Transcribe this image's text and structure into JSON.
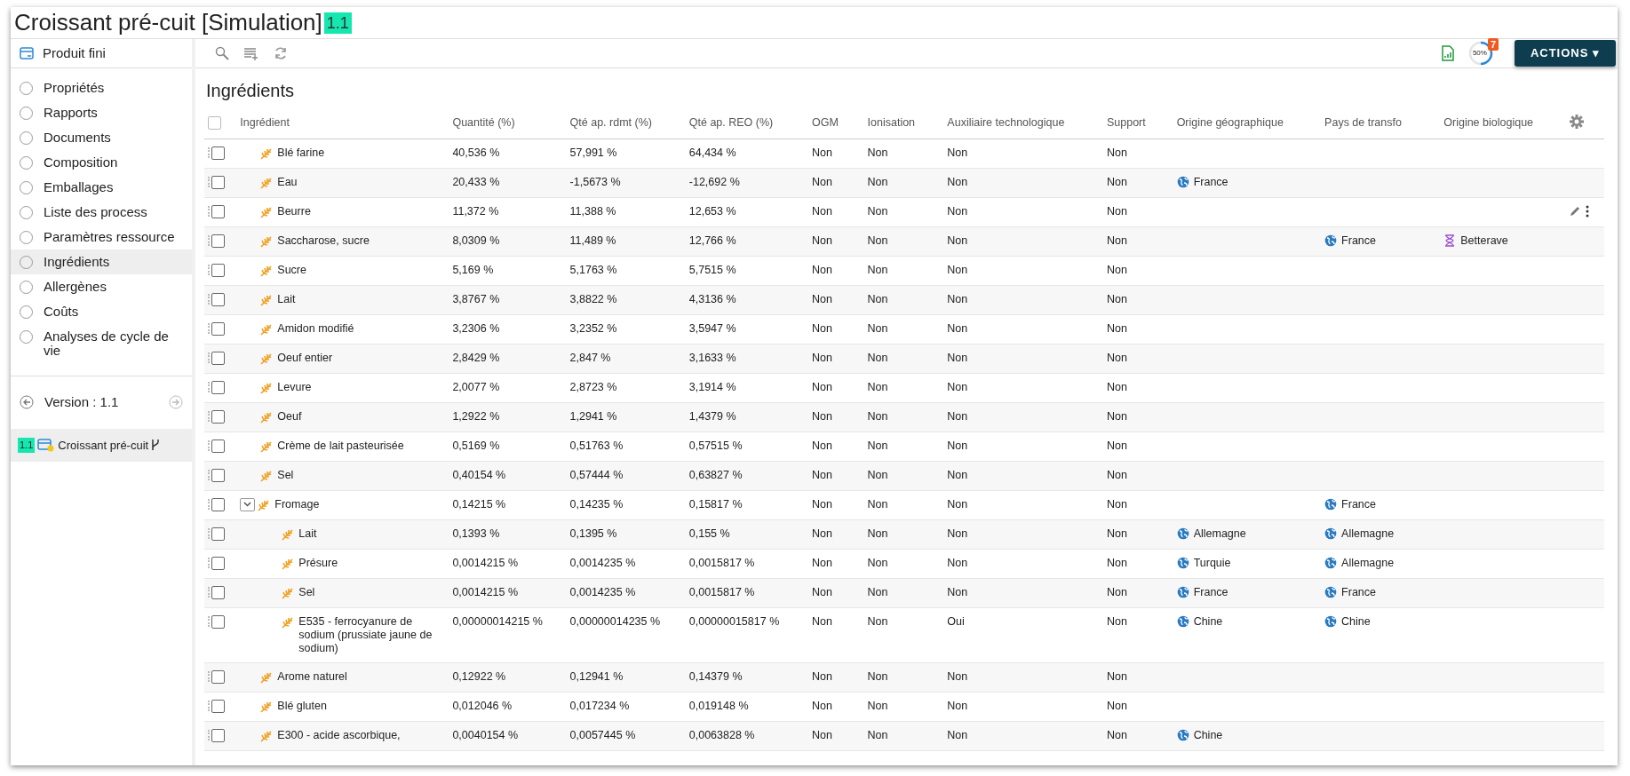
{
  "title": {
    "text": "Croissant pré-cuit [Simulation]",
    "version": "1.1"
  },
  "sidebar": {
    "header": "Produit fini",
    "items": [
      {
        "label": "Propriétés",
        "selected": false
      },
      {
        "label": "Rapports",
        "selected": false
      },
      {
        "label": "Documents",
        "selected": false
      },
      {
        "label": "Composition",
        "selected": false
      },
      {
        "label": "Emballages",
        "selected": false
      },
      {
        "label": "Liste des process",
        "selected": false
      },
      {
        "label": "Paramètres ressource",
        "selected": false
      },
      {
        "label": "Ingrédients",
        "selected": true
      },
      {
        "label": "Allergènes",
        "selected": false
      },
      {
        "label": "Coûts",
        "selected": false
      },
      {
        "label": "Analyses de cycle de vie",
        "selected": false
      }
    ],
    "version_label": "Version : 1.1",
    "version_item": {
      "badge": "1.1",
      "name": "Croissant pré-cuit"
    }
  },
  "toolbar": {
    "progress": {
      "level": 0.5,
      "reading": "50%",
      "count": "7"
    },
    "actions": "ACTIONS ▾"
  },
  "table": {
    "title": "Ingrédients",
    "all_checked": false,
    "columns": [
      {
        "label": "Ingrédient",
        "kind": "name"
      },
      {
        "label": "Quantité (%)",
        "kind": "text"
      },
      {
        "label": "Qté ap. rdmt (%)",
        "kind": "text"
      },
      {
        "label": "Qté ap. REO (%)",
        "kind": "text"
      },
      {
        "label": "OGM",
        "kind": "text"
      },
      {
        "label": "Ionisation",
        "kind": "text"
      },
      {
        "label": "Auxiliaire technologique",
        "kind": "text"
      },
      {
        "label": "Support",
        "kind": "text"
      },
      {
        "label": "Origine géographique",
        "kind": "geo"
      },
      {
        "label": "Pays de transfo",
        "kind": "geo"
      },
      {
        "label": "Origine biologique",
        "kind": "bio"
      }
    ],
    "rows": [
      {
        "cells": [
          "Blé farine",
          "40,536 %",
          "57,991 %",
          "64,434 %",
          "Non",
          "Non",
          "Non",
          "Non",
          null,
          null,
          null
        ],
        "checked": false,
        "hovered": false
      },
      {
        "cells": [
          "Eau",
          "20,433 %",
          "-1,5673 %",
          "-12,692 %",
          "Non",
          "Non",
          "Non",
          "Non",
          "France",
          null,
          null
        ],
        "checked": false,
        "hovered": false
      },
      {
        "cells": [
          "Beurre",
          "11,372 %",
          "11,388 %",
          "12,653 %",
          "Non",
          "Non",
          "Non",
          "Non",
          null,
          null,
          null
        ],
        "checked": false,
        "hovered": true
      },
      {
        "cells": [
          "Saccharose, sucre",
          "8,0309 %",
          "11,489 %",
          "12,766 %",
          "Non",
          "Non",
          "Non",
          "Non",
          null,
          "France",
          "Betterave"
        ],
        "checked": false,
        "hovered": false
      },
      {
        "cells": [
          "Sucre",
          "5,169 %",
          "5,1763 %",
          "5,7515 %",
          "Non",
          "Non",
          "Non",
          "Non",
          null,
          null,
          null
        ],
        "checked": false,
        "hovered": false
      },
      {
        "cells": [
          "Lait",
          "3,8767 %",
          "3,8822 %",
          "4,3136 %",
          "Non",
          "Non",
          "Non",
          "Non",
          null,
          null,
          null
        ],
        "checked": false,
        "hovered": false
      },
      {
        "cells": [
          "Amidon modifié",
          "3,2306 %",
          "3,2352 %",
          "3,5947 %",
          "Non",
          "Non",
          "Non",
          "Non",
          null,
          null,
          null
        ],
        "checked": false,
        "hovered": false
      },
      {
        "cells": [
          "Oeuf entier",
          "2,8429 %",
          "2,847 %",
          "3,1633 %",
          "Non",
          "Non",
          "Non",
          "Non",
          null,
          null,
          null
        ],
        "checked": false,
        "hovered": false
      },
      {
        "cells": [
          "Levure",
          "2,0077 %",
          "2,8723 %",
          "3,1914 %",
          "Non",
          "Non",
          "Non",
          "Non",
          null,
          null,
          null
        ],
        "checked": false,
        "hovered": false
      },
      {
        "cells": [
          "Oeuf",
          "1,2922 %",
          "1,2941 %",
          "1,4379 %",
          "Non",
          "Non",
          "Non",
          "Non",
          null,
          null,
          null
        ],
        "checked": false,
        "hovered": false
      },
      {
        "cells": [
          "Crème de lait pasteurisée",
          "0,5169 %",
          "0,51763 %",
          "0,57515 %",
          "Non",
          "Non",
          "Non",
          "Non",
          null,
          null,
          null
        ],
        "checked": false,
        "hovered": false
      },
      {
        "cells": [
          "Sel",
          "0,40154 %",
          "0,57444 %",
          "0,63827 %",
          "Non",
          "Non",
          "Non",
          "Non",
          null,
          null,
          null
        ],
        "checked": false,
        "hovered": false
      },
      {
        "cells": [
          "Fromage",
          "0,14215 %",
          "0,14235 %",
          "0,15817 %",
          "Non",
          "Non",
          "Non",
          "Non",
          null,
          "France",
          null
        ],
        "checked": false,
        "hovered": false,
        "expanded": true,
        "children": [
          {
            "cells": [
              "Lait",
              "0,1393 %",
              "0,1395 %",
              "0,155 %",
              "Non",
              "Non",
              "Non",
              "Non",
              "Allemagne",
              "Allemagne",
              null
            ],
            "checked": false,
            "hovered": false
          },
          {
            "cells": [
              "Présure",
              "0,0014215 %",
              "0,0014235 %",
              "0,0015817 %",
              "Non",
              "Non",
              "Non",
              "Non",
              "Turquie",
              "Allemagne",
              null
            ],
            "checked": false,
            "hovered": false
          },
          {
            "cells": [
              "Sel",
              "0,0014215 %",
              "0,0014235 %",
              "0,0015817 %",
              "Non",
              "Non",
              "Non",
              "Non",
              "France",
              "France",
              null
            ],
            "checked": false,
            "hovered": false
          },
          {
            "cells": [
              "E535 - ferrocyanure de sodium (prussiate jaune de sodium)",
              "0,00000014215 %",
              "0,00000014235 %",
              "0,00000015817 %",
              "Non",
              "Non",
              "Oui",
              "Non",
              "Chine",
              "Chine",
              null
            ],
            "checked": false,
            "hovered": false
          }
        ]
      },
      {
        "cells": [
          "Arome naturel",
          "0,12922 %",
          "0,12941 %",
          "0,14379 %",
          "Non",
          "Non",
          "Non",
          "Non",
          null,
          null,
          null
        ],
        "checked": false,
        "hovered": false
      },
      {
        "cells": [
          "Blé gluten",
          "0,012046 %",
          "0,017234 %",
          "0,019148 %",
          "Non",
          "Non",
          "Non",
          "Non",
          null,
          null,
          null
        ],
        "checked": false,
        "hovered": false
      },
      {
        "cells": [
          "E300 - acide ascorbique,",
          "0,0040154 %",
          "0,0057445 %",
          "0,0063828 %",
          "Non",
          "Non",
          "Non",
          "Non",
          "Chine",
          null,
          null
        ],
        "checked": false,
        "hovered": false
      }
    ]
  }
}
